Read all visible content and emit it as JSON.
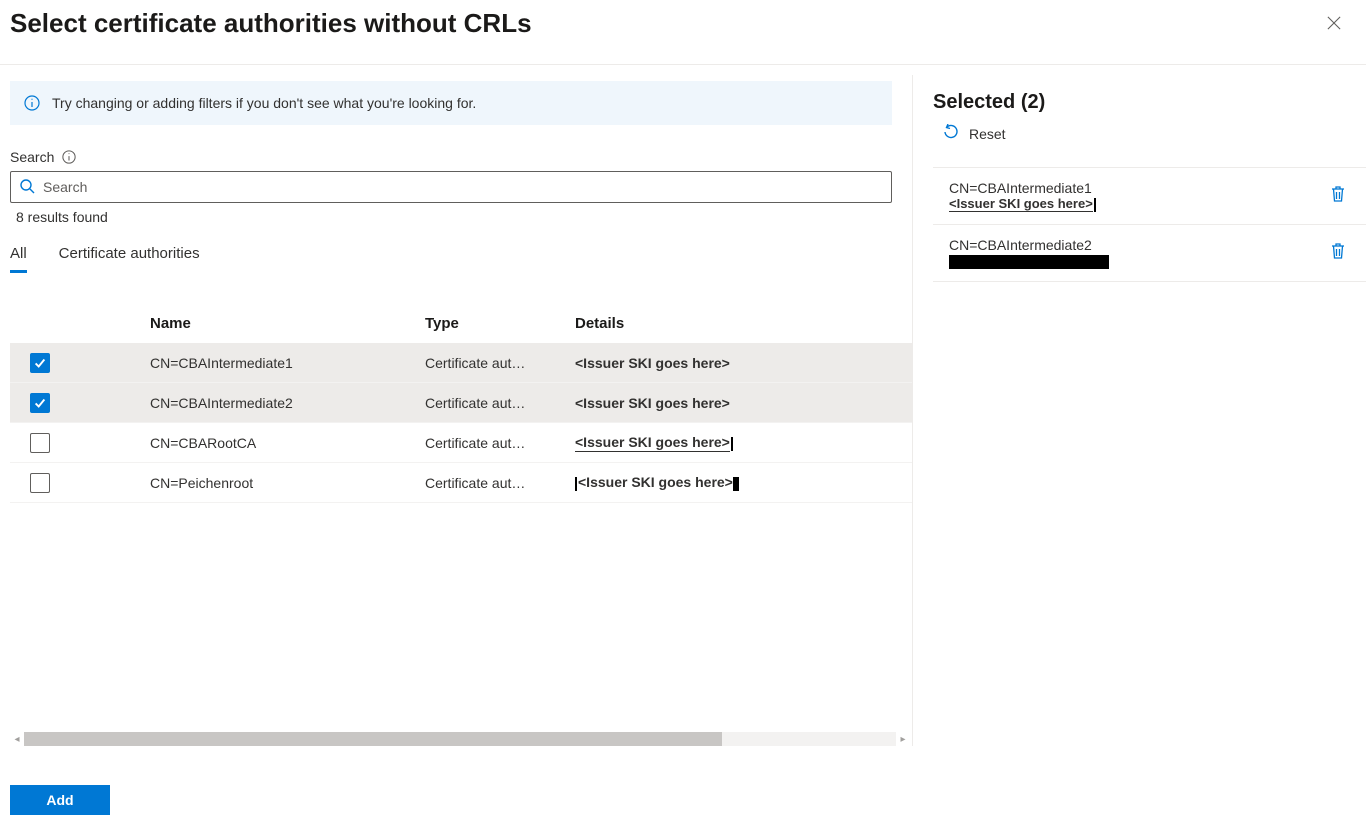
{
  "header": {
    "title": "Select certificate authorities without CRLs"
  },
  "info": {
    "text": "Try changing or adding filters if you don't see what you're looking for."
  },
  "search": {
    "label": "Search",
    "placeholder": "Search",
    "results_text": "8 results found"
  },
  "tabs": {
    "all": "All",
    "ca": "Certificate authorities"
  },
  "grid": {
    "cols": {
      "name": "Name",
      "type": "Type",
      "details": "Details"
    },
    "type_trunc": "Certificate aut…",
    "rows": [
      {
        "checked": true,
        "name": "CN=CBAIntermediate1",
        "details": "<Issuer SKI goes here>",
        "details_style": "plain"
      },
      {
        "checked": true,
        "name": "CN=CBAIntermediate2",
        "details": "<Issuer SKI goes here>",
        "details_style": "plain"
      },
      {
        "checked": false,
        "name": "CN=CBARootCA",
        "details": "<Issuer SKI goes here>",
        "details_style": "underline-cursor"
      },
      {
        "checked": false,
        "name": "CN=Peichenroot",
        "details": "<Issuer SKI goes here>",
        "details_style": "side-cursors"
      }
    ]
  },
  "selected": {
    "title": "Selected (2)",
    "reset": "Reset",
    "items": [
      {
        "name": "CN=CBAIntermediate1",
        "ski": "<Issuer SKI goes here>",
        "ski_style": "bold-cursor"
      },
      {
        "name": "CN=CBAIntermediate2",
        "ski": "",
        "ski_style": "redacted"
      }
    ]
  },
  "footer": {
    "add": "Add"
  }
}
